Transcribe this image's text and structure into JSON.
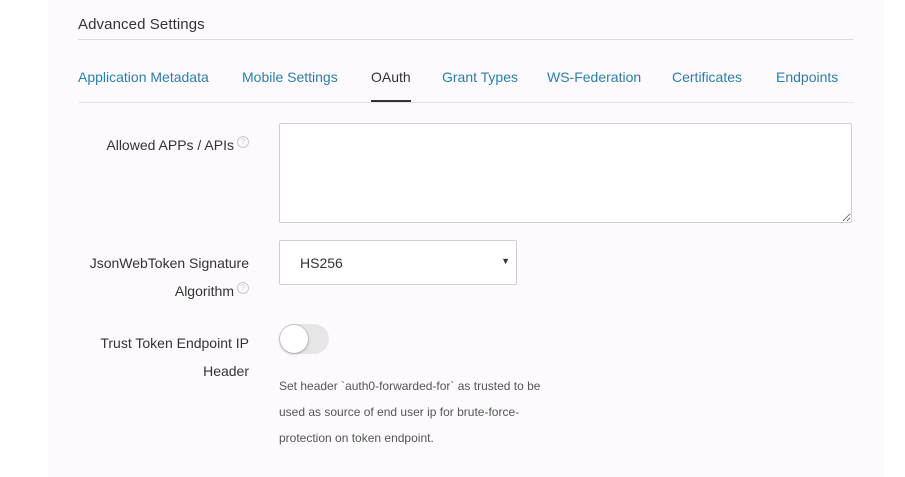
{
  "section": {
    "title": "Advanced Settings"
  },
  "tabs": [
    {
      "label": "Application Metadata",
      "active": false
    },
    {
      "label": "Mobile Settings",
      "active": false
    },
    {
      "label": "OAuth",
      "active": true
    },
    {
      "label": "Grant Types",
      "active": false
    },
    {
      "label": "WS-Federation",
      "active": false
    },
    {
      "label": "Certificates",
      "active": false
    },
    {
      "label": "Endpoints",
      "active": false
    }
  ],
  "fields": {
    "allowed_apps": {
      "label": "Allowed APPs / APIs",
      "value": ""
    },
    "jwt_algorithm": {
      "label_line1": "JsonWebToken Signature",
      "label_line2": "Algorithm",
      "selected": "HS256"
    },
    "trust_token": {
      "label_line1": "Trust Token Endpoint IP",
      "label_line2": "Header",
      "enabled": false,
      "help_line1": "Set header `auth0-forwarded-for` as trusted to be",
      "help_line2": "used as source of end user ip for brute-force-",
      "help_line3": "protection on token endpoint."
    }
  },
  "icons": {
    "help": "question-circle-icon",
    "select_caret": "caret-down-icon"
  },
  "colors": {
    "link": "#2c7ea8",
    "panel_bg": "#fdfafd",
    "toggle_off": "#e6e6e6"
  }
}
